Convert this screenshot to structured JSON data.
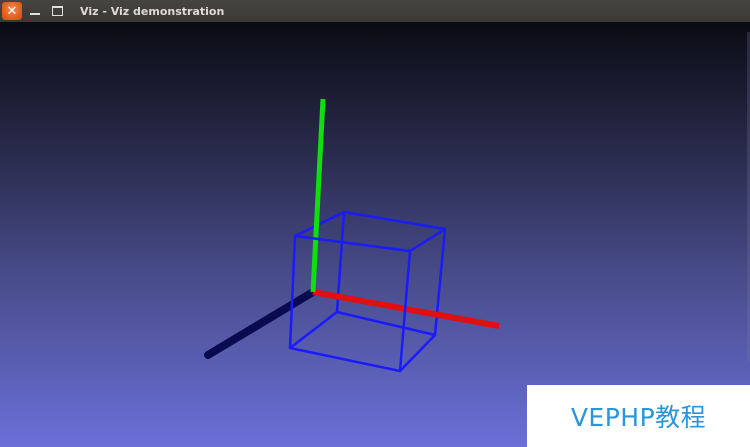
{
  "window": {
    "title": "Viz - Viz demonstration",
    "close_glyph": "✕",
    "icons": [
      "close-icon",
      "minimize-icon",
      "maximize-icon"
    ]
  },
  "scene": {
    "background_top": "#0b0b14",
    "background_bottom": "#6b6fd8",
    "cube_color": "#1a1aff",
    "axes": [
      {
        "name": "x-axis",
        "color": "#e01010"
      },
      {
        "name": "y-axis",
        "color": "#11dd11"
      },
      {
        "name": "z-axis",
        "color": "#0a0a50"
      }
    ]
  },
  "watermark": {
    "text": "VEPHP教程"
  }
}
